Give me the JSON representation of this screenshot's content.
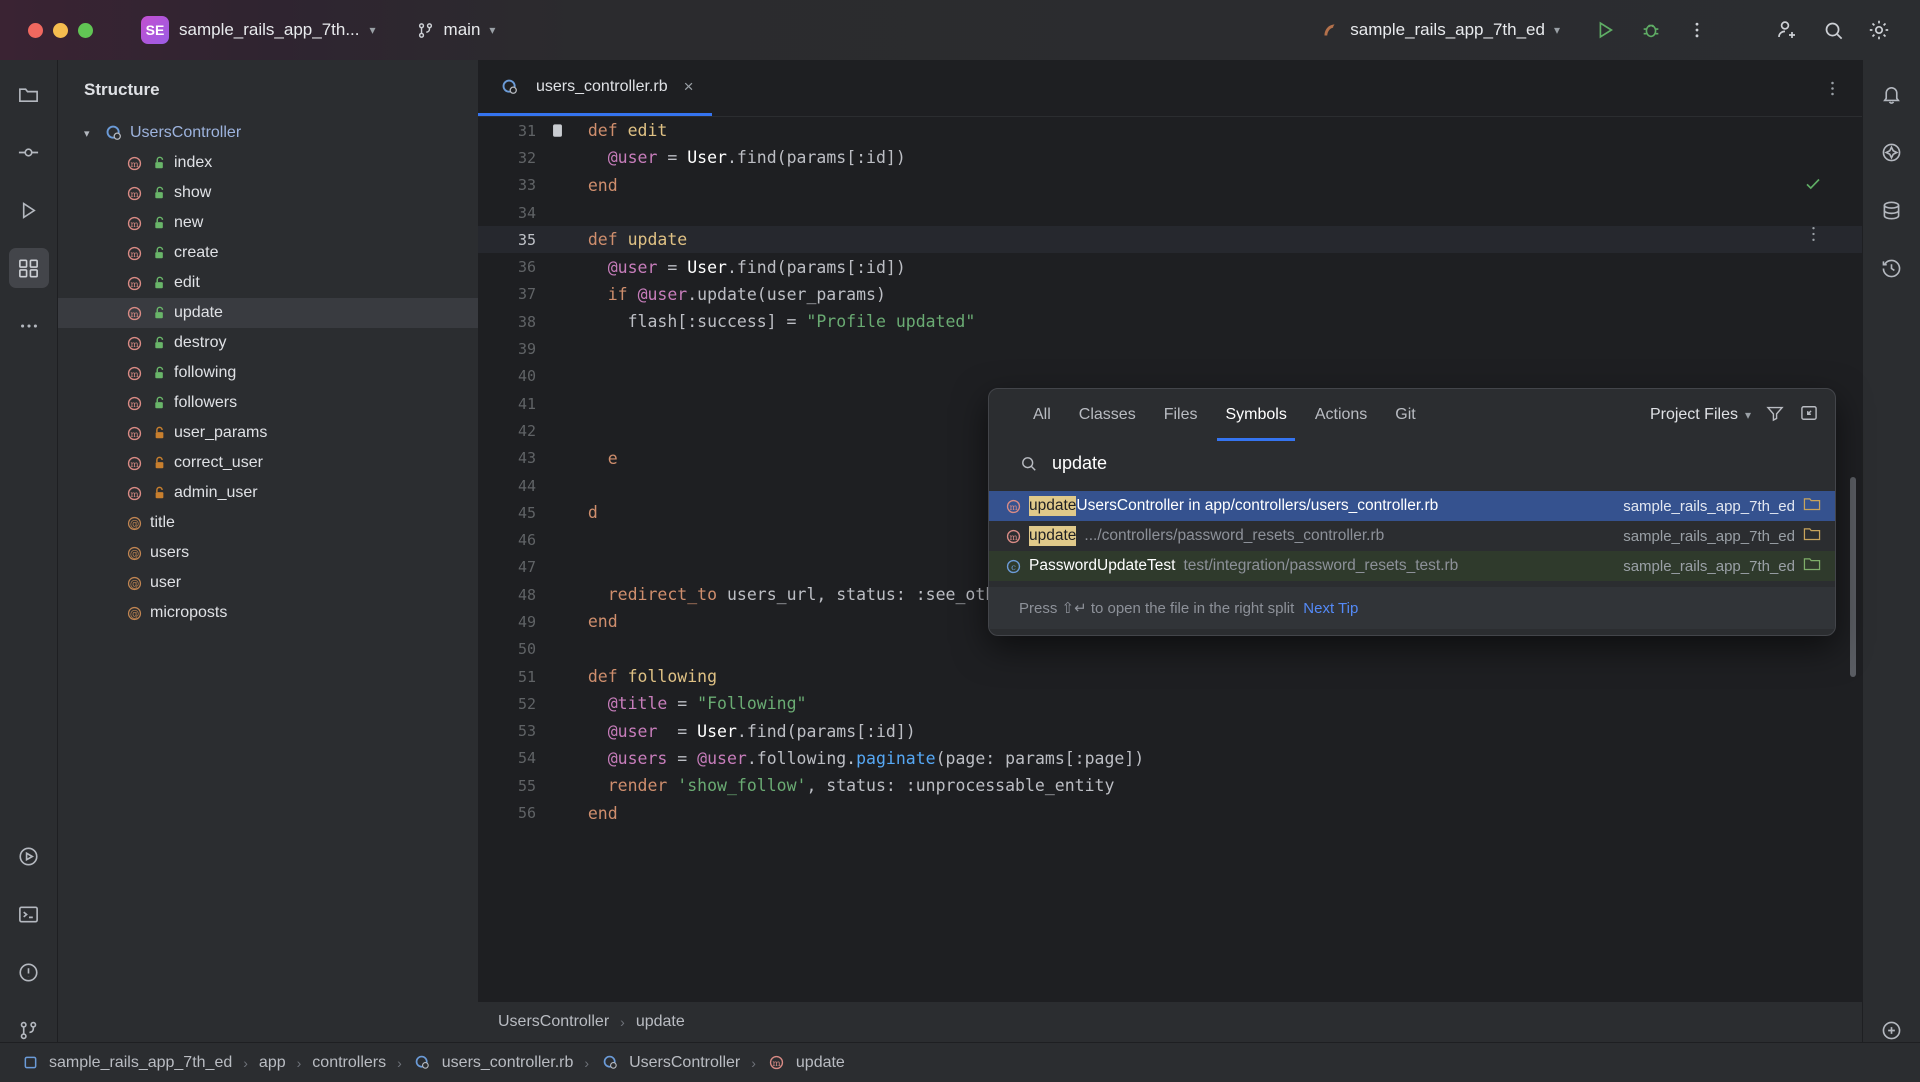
{
  "titlebar": {
    "project_badge": "SE",
    "project_name": "sample_rails_app_7th...",
    "branch": "main",
    "run_config": "sample_rails_app_7th_ed",
    "icons": {
      "run": "run-icon",
      "debug": "debug-icon",
      "more": "more-vertical-icon",
      "add_user": "add-user-icon",
      "search": "search-icon",
      "settings": "gear-icon"
    }
  },
  "left_rail": {
    "items": [
      {
        "name": "project-icon",
        "glyph": "folder"
      },
      {
        "name": "commit-icon",
        "glyph": "commit"
      },
      {
        "name": "run-panel-icon",
        "glyph": "play"
      },
      {
        "name": "structure-icon",
        "glyph": "structure"
      },
      {
        "name": "more-tools-icon",
        "glyph": "dots"
      }
    ],
    "bottom_items": [
      {
        "name": "run-tool-icon",
        "glyph": "play-circle"
      },
      {
        "name": "terminal-icon",
        "glyph": "terminal"
      },
      {
        "name": "problems-icon",
        "glyph": "warning-circle"
      },
      {
        "name": "version-control-icon",
        "glyph": "branch"
      }
    ]
  },
  "right_rail": {
    "items": [
      {
        "name": "notifications-icon",
        "glyph": "bell"
      },
      {
        "name": "ai-assistant-icon",
        "glyph": "ai"
      },
      {
        "name": "database-icon",
        "glyph": "database"
      },
      {
        "name": "history-icon",
        "glyph": "history"
      }
    ],
    "bottom_items": [
      {
        "name": "ai-chat-icon",
        "glyph": "ai-chat"
      }
    ]
  },
  "structure": {
    "title": "Structure",
    "root": {
      "label": "UsersController",
      "icon": "ruby-class-icon",
      "expanded": true
    },
    "items": [
      {
        "label": "index",
        "icon": "method-icon",
        "visibility": "public"
      },
      {
        "label": "show",
        "icon": "method-icon",
        "visibility": "public"
      },
      {
        "label": "new",
        "icon": "method-icon",
        "visibility": "public"
      },
      {
        "label": "create",
        "icon": "method-icon",
        "visibility": "public"
      },
      {
        "label": "edit",
        "icon": "method-icon",
        "visibility": "public"
      },
      {
        "label": "update",
        "icon": "method-icon",
        "visibility": "public",
        "selected": true
      },
      {
        "label": "destroy",
        "icon": "method-icon",
        "visibility": "public"
      },
      {
        "label": "following",
        "icon": "method-icon",
        "visibility": "public"
      },
      {
        "label": "followers",
        "icon": "method-icon",
        "visibility": "public"
      },
      {
        "label": "user_params",
        "icon": "method-icon",
        "visibility": "private"
      },
      {
        "label": "correct_user",
        "icon": "method-icon",
        "visibility": "private"
      },
      {
        "label": "admin_user",
        "icon": "method-icon",
        "visibility": "private"
      },
      {
        "label": "title",
        "icon": "ivar-icon",
        "visibility": "none"
      },
      {
        "label": "users",
        "icon": "ivar-icon",
        "visibility": "none"
      },
      {
        "label": "user",
        "icon": "ivar-icon",
        "visibility": "none"
      },
      {
        "label": "microposts",
        "icon": "ivar-icon",
        "visibility": "none"
      }
    ]
  },
  "editor": {
    "tab": {
      "label": "users_controller.rb",
      "icon": "ruby-class-icon",
      "close": "×"
    },
    "current_line": 35,
    "lines": [
      {
        "n": 31,
        "mark": "bookmark-icon",
        "tokens": [
          {
            "t": "  ",
            "c": "op"
          },
          {
            "t": "def ",
            "c": "kw"
          },
          {
            "t": "edit",
            "c": "meth"
          }
        ]
      },
      {
        "n": 32,
        "tokens": [
          {
            "t": "    ",
            "c": "op"
          },
          {
            "t": "@user",
            "c": "ivar"
          },
          {
            "t": " = ",
            "c": "op"
          },
          {
            "t": "User",
            "c": "const"
          },
          {
            "t": ".find(params[:id])",
            "c": "op"
          }
        ]
      },
      {
        "n": 33,
        "tokens": [
          {
            "t": "  ",
            "c": "op"
          },
          {
            "t": "end",
            "c": "kw"
          }
        ]
      },
      {
        "n": 34,
        "tokens": []
      },
      {
        "n": 35,
        "tokens": [
          {
            "t": "  ",
            "c": "op"
          },
          {
            "t": "def ",
            "c": "kw"
          },
          {
            "t": "update",
            "c": "meth"
          }
        ]
      },
      {
        "n": 36,
        "tokens": [
          {
            "t": "    ",
            "c": "op"
          },
          {
            "t": "@user",
            "c": "ivar"
          },
          {
            "t": " = ",
            "c": "op"
          },
          {
            "t": "User",
            "c": "const"
          },
          {
            "t": ".find(params[:id])",
            "c": "op"
          }
        ]
      },
      {
        "n": 37,
        "tokens": [
          {
            "t": "    ",
            "c": "op"
          },
          {
            "t": "if ",
            "c": "kw"
          },
          {
            "t": "@user",
            "c": "ivar"
          },
          {
            "t": ".update(user_params)",
            "c": "op"
          }
        ]
      },
      {
        "n": 38,
        "tokens": [
          {
            "t": "      ",
            "c": "op"
          },
          {
            "t": "flash[:success] = ",
            "c": "op"
          },
          {
            "t": "\"Profile updated\"",
            "c": "str"
          }
        ]
      },
      {
        "n": 39,
        "tokens": []
      },
      {
        "n": 40,
        "tokens": []
      },
      {
        "n": 41,
        "tokens": []
      },
      {
        "n": 42,
        "tokens": []
      },
      {
        "n": 43,
        "tokens": [
          {
            "t": "    e",
            "c": "kw"
          }
        ]
      },
      {
        "n": 44,
        "tokens": []
      },
      {
        "n": 45,
        "tokens": [
          {
            "t": "  d",
            "c": "kw"
          }
        ]
      },
      {
        "n": 46,
        "tokens": []
      },
      {
        "n": 47,
        "tokens": []
      },
      {
        "n": 48,
        "tokens": [
          {
            "t": "    ",
            "c": "op"
          },
          {
            "t": "redirect_to ",
            "c": "kw"
          },
          {
            "t": "users_url, ",
            "c": "op"
          },
          {
            "t": "status:",
            "c": "op"
          },
          {
            "t": " :see_other",
            "c": "op"
          }
        ]
      },
      {
        "n": 49,
        "tokens": [
          {
            "t": "  ",
            "c": "op"
          },
          {
            "t": "end",
            "c": "kw"
          }
        ]
      },
      {
        "n": 50,
        "tokens": []
      },
      {
        "n": 51,
        "tokens": [
          {
            "t": "  ",
            "c": "op"
          },
          {
            "t": "def ",
            "c": "kw"
          },
          {
            "t": "following",
            "c": "meth"
          }
        ]
      },
      {
        "n": 52,
        "tokens": [
          {
            "t": "    ",
            "c": "op"
          },
          {
            "t": "@title",
            "c": "ivar"
          },
          {
            "t": " = ",
            "c": "op"
          },
          {
            "t": "\"Following\"",
            "c": "str"
          }
        ]
      },
      {
        "n": 53,
        "tokens": [
          {
            "t": "    ",
            "c": "op"
          },
          {
            "t": "@user",
            "c": "ivar"
          },
          {
            "t": "  = ",
            "c": "op"
          },
          {
            "t": "User",
            "c": "const"
          },
          {
            "t": ".find(params[:id])",
            "c": "op"
          }
        ]
      },
      {
        "n": 54,
        "tokens": [
          {
            "t": "    ",
            "c": "op"
          },
          {
            "t": "@users",
            "c": "ivar"
          },
          {
            "t": " = ",
            "c": "op"
          },
          {
            "t": "@user",
            "c": "ivar"
          },
          {
            "t": ".following.",
            "c": "op"
          },
          {
            "t": "paginate",
            "c": "fn"
          },
          {
            "t": "(page: params[:page])",
            "c": "op"
          }
        ]
      },
      {
        "n": 55,
        "tokens": [
          {
            "t": "    ",
            "c": "op"
          },
          {
            "t": "render ",
            "c": "kw"
          },
          {
            "t": "'show_follow'",
            "c": "str"
          },
          {
            "t": ", status: :unprocessable_entity",
            "c": "op"
          }
        ]
      },
      {
        "n": 56,
        "tokens": [
          {
            "t": "  ",
            "c": "op"
          },
          {
            "t": "end",
            "c": "kw"
          }
        ]
      }
    ]
  },
  "search_everywhere": {
    "tabs": [
      {
        "label": "All",
        "active": false
      },
      {
        "label": "Classes",
        "active": false
      },
      {
        "label": "Files",
        "active": false
      },
      {
        "label": "Symbols",
        "active": true
      },
      {
        "label": "Actions",
        "active": false
      },
      {
        "label": "Git",
        "active": false
      }
    ],
    "scope": "Project Files",
    "filter_icon": "filter-icon",
    "expand_icon": "expand-icon",
    "search_icon": "search-icon",
    "query": "update",
    "results": [
      {
        "icon": "method-icon",
        "highlight": "update",
        "primary": " UsersController in app/controllers/users_controller.rb",
        "secondary": "",
        "project": "sample_rails_app_7th_ed",
        "module_icon": "module-icon",
        "state": "selected"
      },
      {
        "icon": "method-icon",
        "highlight": "update",
        "primary": "",
        "secondary": ".../controllers/password_resets_controller.rb",
        "project": "sample_rails_app_7th_ed",
        "module_icon": "module-icon",
        "state": "normal"
      },
      {
        "icon": "class-icon",
        "highlight": "",
        "primary": "PasswordUpdateTest",
        "secondary": "test/integration/password_resets_test.rb",
        "project": "sample_rails_app_7th_ed",
        "module_icon": "test-module-icon",
        "state": "test"
      }
    ],
    "footer": {
      "text": "Press ⇧↵ to open the file in the right split",
      "link": "Next Tip"
    }
  },
  "breadcrumbs_upper": [
    "UsersController",
    "update"
  ],
  "breadcrumbs_bottom": [
    {
      "label": "sample_rails_app_7th_ed",
      "icon": "project-icon"
    },
    {
      "label": "app",
      "icon": null
    },
    {
      "label": "controllers",
      "icon": null
    },
    {
      "label": "users_controller.rb",
      "icon": "ruby-class-icon"
    },
    {
      "label": "UsersController",
      "icon": "ruby-class-icon"
    },
    {
      "label": "update",
      "icon": "method-icon"
    }
  ],
  "colors": {
    "accent": "#3574f0",
    "selection": "#35528f",
    "highlight": "#e0c98a",
    "test_row": "#2f3a2c",
    "panel_bg": "#2b2d30",
    "editor_bg": "#1e1f22"
  }
}
